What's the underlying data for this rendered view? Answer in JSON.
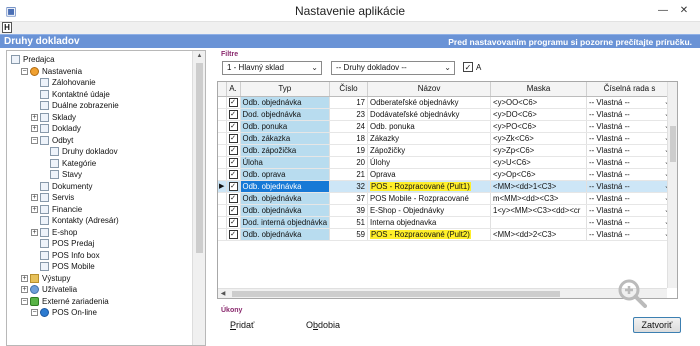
{
  "window": {
    "title": "Nastavenie aplikácie",
    "menu_icon": "H"
  },
  "header": {
    "section_title": "Druhy dokladov",
    "notice": "Pred nastavovaním programu si pozorne prečítajte príručku."
  },
  "tree": {
    "items": [
      {
        "label": "Predajca",
        "icon": "document-icon",
        "level": 0,
        "expander": ""
      },
      {
        "label": "Nastavenia",
        "icon": "gear-icon",
        "level": 1,
        "expander": "−"
      },
      {
        "label": "Zálohovanie",
        "icon": "document-icon",
        "level": 2,
        "expander": ""
      },
      {
        "label": "Kontaktné údaje",
        "icon": "document-icon",
        "level": 2,
        "expander": ""
      },
      {
        "label": "Duálne zobrazenie",
        "icon": "document-icon",
        "level": 2,
        "expander": ""
      },
      {
        "label": "Sklady",
        "icon": "document-icon",
        "level": 2,
        "expander": "+"
      },
      {
        "label": "Doklady",
        "icon": "document-icon",
        "level": 2,
        "expander": "+"
      },
      {
        "label": "Odbyt",
        "icon": "document-icon",
        "level": 2,
        "expander": "−"
      },
      {
        "label": "Druhy dokladov",
        "icon": "document-icon",
        "level": 3,
        "expander": ""
      },
      {
        "label": "Kategórie",
        "icon": "document-icon",
        "level": 3,
        "expander": ""
      },
      {
        "label": "Stavy",
        "icon": "document-icon",
        "level": 3,
        "expander": ""
      },
      {
        "label": "Dokumenty",
        "icon": "document-icon",
        "level": 2,
        "expander": ""
      },
      {
        "label": "Servis",
        "icon": "document-icon",
        "level": 2,
        "expander": "+"
      },
      {
        "label": "Financie",
        "icon": "document-icon",
        "level": 2,
        "expander": "+"
      },
      {
        "label": "Kontakty (Adresár)",
        "icon": "document-icon",
        "level": 2,
        "expander": ""
      },
      {
        "label": "E-shop",
        "icon": "document-icon",
        "level": 2,
        "expander": "+"
      },
      {
        "label": "POS Predaj",
        "icon": "document-icon",
        "level": 2,
        "expander": ""
      },
      {
        "label": "POS Info box",
        "icon": "document-icon",
        "level": 2,
        "expander": ""
      },
      {
        "label": "POS Mobile",
        "icon": "document-icon",
        "level": 2,
        "expander": ""
      },
      {
        "label": "Výstupy",
        "icon": "folder-icon",
        "level": 1,
        "expander": "+"
      },
      {
        "label": "Užívatelia",
        "icon": "users-icon",
        "level": 1,
        "expander": "+"
      },
      {
        "label": "Externé zariadenia",
        "icon": "device-icon",
        "level": 1,
        "expander": "−"
      },
      {
        "label": "POS On-line",
        "icon": "globe-icon",
        "level": 2,
        "expander": "−"
      }
    ]
  },
  "filters": {
    "label": "Filtre",
    "warehouse": "1 - Hlavný sklad",
    "doc_type": "-- Druhy dokladov --",
    "checkbox_label": "A",
    "checkbox_checked": true
  },
  "grid": {
    "columns": [
      "A.",
      "Typ",
      "Číslo",
      "Názov",
      "Maska",
      "Číselná rada s"
    ],
    "rows": [
      {
        "checked": true,
        "typ": "Odb. objednávka",
        "cislo": "17",
        "nazov": "Odberateľské objednávky",
        "maska": "<y>OO<C6>",
        "rada": "-- Vlastná --",
        "selected": false,
        "highlight": false
      },
      {
        "checked": true,
        "typ": "Dod. objednávka",
        "cislo": "23",
        "nazov": "Dodávateľské objednávky",
        "maska": "<y>DO<C6>",
        "rada": "-- Vlastná --",
        "selected": false,
        "highlight": false
      },
      {
        "checked": true,
        "typ": "Odb. ponuka",
        "cislo": "24",
        "nazov": "Odb. ponuka",
        "maska": "<y>PO<C6>",
        "rada": "-- Vlastná --",
        "selected": false,
        "highlight": false
      },
      {
        "checked": true,
        "typ": "Odb. zákazka",
        "cislo": "18",
        "nazov": "Zákazky",
        "maska": "<y>Zk<C6>",
        "rada": "-- Vlastná --",
        "selected": false,
        "highlight": false
      },
      {
        "checked": true,
        "typ": "Odb. zápožička",
        "cislo": "19",
        "nazov": "Zápožičky",
        "maska": "<y>Zp<C6>",
        "rada": "-- Vlastná --",
        "selected": false,
        "highlight": false
      },
      {
        "checked": true,
        "typ": "Úloha",
        "cislo": "20",
        "nazov": "Úlohy",
        "maska": "<y>U<C6>",
        "rada": "-- Vlastná --",
        "selected": false,
        "highlight": false
      },
      {
        "checked": true,
        "typ": "Odb. oprava",
        "cislo": "21",
        "nazov": "Oprava",
        "maska": "<y>Op<C6>",
        "rada": "-- Vlastná --",
        "selected": false,
        "highlight": false
      },
      {
        "checked": true,
        "typ": "Odb. objednávka",
        "cislo": "32",
        "nazov": "POS - Rozpracované (Pult1)",
        "maska": "<MM><dd>1<C3>",
        "rada": "-- Vlastná --",
        "selected": true,
        "highlight": true
      },
      {
        "checked": true,
        "typ": "Odb. objednávka",
        "cislo": "37",
        "nazov": "POS Mobile - Rozpracované",
        "maska": "m<MM><dd><C3>",
        "rada": "-- Vlastná --",
        "selected": false,
        "highlight": false
      },
      {
        "checked": true,
        "typ": "Odb. objednávka",
        "cislo": "39",
        "nazov": "E-Shop - Objednávky",
        "maska": "1<y><MM><C3><dd><cr",
        "rada": "-- Vlastná --",
        "selected": false,
        "highlight": false
      },
      {
        "checked": true,
        "typ": "Dod. interná objednávka",
        "cislo": "51",
        "nazov": "Interna objednavka",
        "maska": "",
        "rada": "-- Vlastná --",
        "selected": false,
        "highlight": false
      },
      {
        "checked": true,
        "typ": "Odb. objednávka",
        "cislo": "59",
        "nazov": "POS - Rozpracované (Pult2)",
        "maska": "<MM><dd>2<C3>",
        "rada": "-- Vlastná --",
        "selected": false,
        "highlight": true
      }
    ]
  },
  "actions": {
    "label": "Úkony",
    "add": "Pridať",
    "period": "Obdobia",
    "close": "Zatvoriť"
  },
  "colors": {
    "header_blue": "#6a93d6",
    "selection_blue": "#1779d6",
    "type_column": "#b8dcef",
    "highlight_yellow": "#ffef2a",
    "section_label": "#8a2a6e"
  }
}
